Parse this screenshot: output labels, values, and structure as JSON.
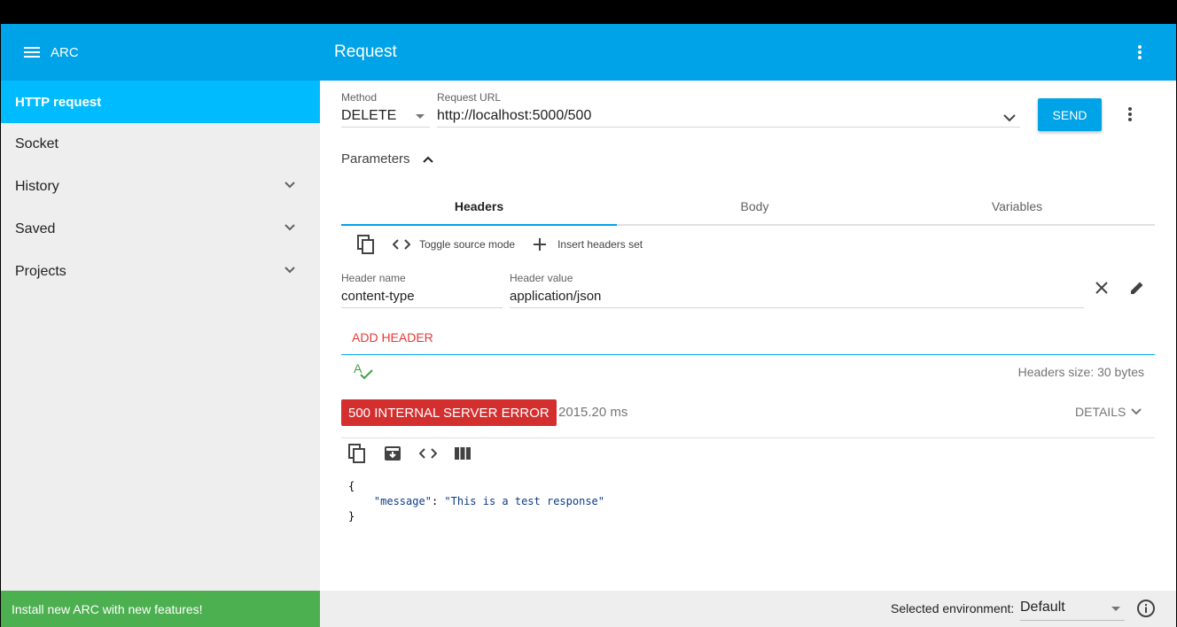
{
  "app": {
    "title": "ARC",
    "page_title": "Request",
    "brand_color": "#00a2e8"
  },
  "sidebar": {
    "items": [
      {
        "label": "HTTP request",
        "active": true
      },
      {
        "label": "Socket"
      },
      {
        "label": "History",
        "expandable": true
      },
      {
        "label": "Saved",
        "expandable": true
      },
      {
        "label": "Projects",
        "expandable": true
      }
    ],
    "promo": "Install new ARC with new features!"
  },
  "request": {
    "method_label": "Method",
    "method_value": "DELETE",
    "url_label": "Request URL",
    "url_value": "http://localhost:5000/500",
    "send_label": "SEND",
    "parameters_label": "Parameters"
  },
  "tabs": [
    {
      "label": "Headers",
      "active": true
    },
    {
      "label": "Body"
    },
    {
      "label": "Variables"
    }
  ],
  "headers_editor": {
    "toggle_source": "Toggle source mode",
    "insert_set": "Insert headers set",
    "name_label": "Header name",
    "name_value": "content-type",
    "value_label": "Header value",
    "value_value": "application/json",
    "add_header": "ADD HEADER",
    "headers_size": "Headers size: 30 bytes"
  },
  "response": {
    "status": "500 INTERNAL SERVER ERROR",
    "status_color": "#d32f2f",
    "time": "2015.20 ms",
    "details": "DETAILS",
    "body_open": "{",
    "body_key": "\"message\"",
    "body_sep": ": ",
    "body_value": "\"This is a test response\"",
    "body_close": "}"
  },
  "footer": {
    "env_label": "Selected environment:",
    "env_value": "Default"
  }
}
